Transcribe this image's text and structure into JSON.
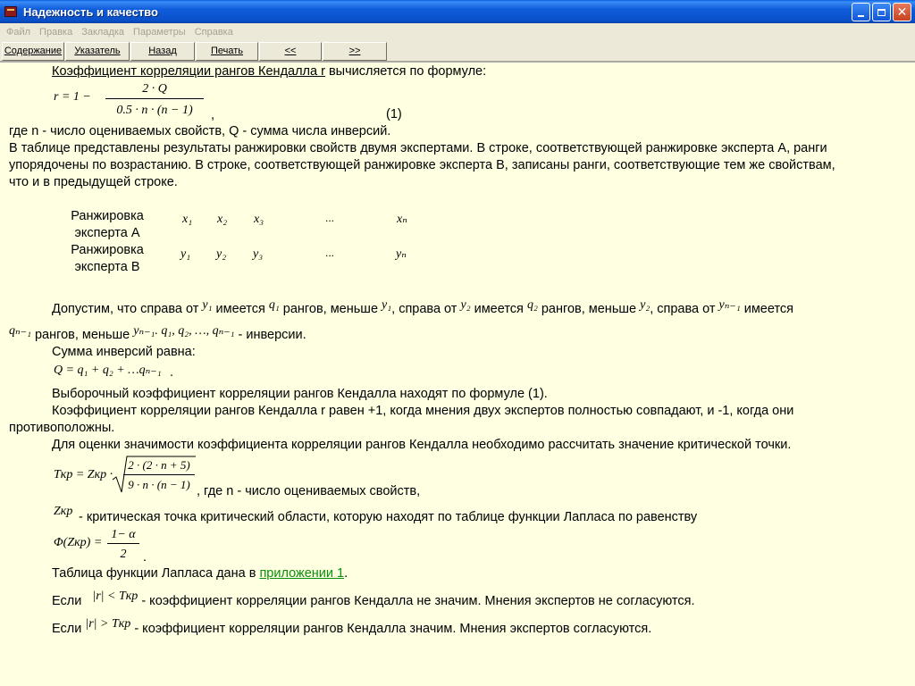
{
  "window": {
    "title": "Надежность и качество",
    "minimize_icon": "minimize-icon",
    "maximize_icon": "restore-icon",
    "close_icon": "close-icon"
  },
  "menu": [
    "Файл",
    "Правка",
    "Закладка",
    "Параметры",
    "Справка"
  ],
  "toolbar": [
    "Содержание",
    "Указатель",
    "Назад",
    "Печать",
    "<<",
    ">>"
  ],
  "content": {
    "intro_underlined": "Коэффициент корреляции рангов Кендалла r",
    "intro_rest": " вычисляется по формуле:",
    "formula1": {
      "lhs": "r = 1 −",
      "num": "2 · Q",
      "den": "0.5 · n · (n − 1)",
      "comma": ",",
      "number": "(1)"
    },
    "where_line": "где n - число оцениваемых свойств, Q - сумма числа инверсий.",
    "paragraph_lines": [
      "В таблице представлены результаты ранжировки свойств двумя экспертами. В строке, соответствующей ранжировке эксперта А, ранги",
      "упорядочены по возрастанию. В строке, соответствующей ранжировке эксперта В, записаны ранги, соответствующие тем же свойствам,",
      "что и в предыдущей строке."
    ],
    "table": {
      "row_a_label1": "Ранжировка",
      "row_a_label2": "эксперта А",
      "row_b_label1": "Ранжировка",
      "row_b_label2": "эксперта В",
      "row_a": [
        "x₁",
        "x₂",
        "x₃",
        "...",
        "xₙ"
      ],
      "row_b": [
        "y₁",
        "y₂",
        "y₃",
        "...",
        "yₙ"
      ]
    },
    "assume_line1": {
      "t1": "Допустим, что справа от",
      "m1": "y₁",
      "t2": "имеется",
      "m2": "q₁",
      "t3": "рангов, меньше",
      "m3": "y₁",
      "t4": ", справа от",
      "m4": "y₂",
      "t5": "имеется",
      "m5": "q₂",
      "t6": "рангов, меньше",
      "m6": "y₂",
      "t7": ", справа от",
      "m7": "yₙ₋₁",
      "t8": "имеется"
    },
    "assume_line2": {
      "m1": "qₙ₋₁",
      "t1": "рангов, меньше",
      "m2": "yₙ₋₁",
      "m3": ". q₁, q₂, …, qₙ₋₁",
      "t2": "- инверсии."
    },
    "sum_title": "Сумма инверсий равна:",
    "sum_formula": "Q = q₁ + q₂ + …qₙ₋₁",
    "sum_dot": ".",
    "selective": "Выборочный коэффициент корреляции рангов Кендалла находят по формуле (1).",
    "equals_line1": "Коэффициент корреляции рангов Кендалла r равен +1, когда мнения двух экспертов полностью совпадают, и -1, когда они",
    "equals_line2": "противоположны.",
    "critical_intro": "Для оценки значимости коэффициента корреляции рангов Кендалла необходимо рассчитать значение критической точки.",
    "t_formula": {
      "lhs": "Tкр = Zкр ·",
      "num": "2 · (2 · n + 5)",
      "den": "9 · n · (n − 1)",
      "after": ", где n - число оцениваемых свойств,"
    },
    "z_label": "Zкр",
    "z_text": "- критическая точка критический области, которую находят по таблице функции Лапласа по равенству",
    "phi_formula": {
      "lhs": "Φ(Zкр) =",
      "num": "1− α",
      "den": "2",
      "dot": "."
    },
    "laplace_text": "Таблица функции Лапласа дана в ",
    "laplace_link": "приложении 1",
    "laplace_end": ".",
    "if1": {
      "t1": "Если",
      "m": "|r| < Tкр",
      "t2": "- коэффициент корреляции рангов Кендалла  не значим. Мнения экспертов не согласуются."
    },
    "if2": {
      "t1": "Если",
      "m": "|r| > Tкр",
      "t2": "- коэффициент корреляции рангов Кендалла значим. Мнения экспертов согласуются."
    }
  }
}
